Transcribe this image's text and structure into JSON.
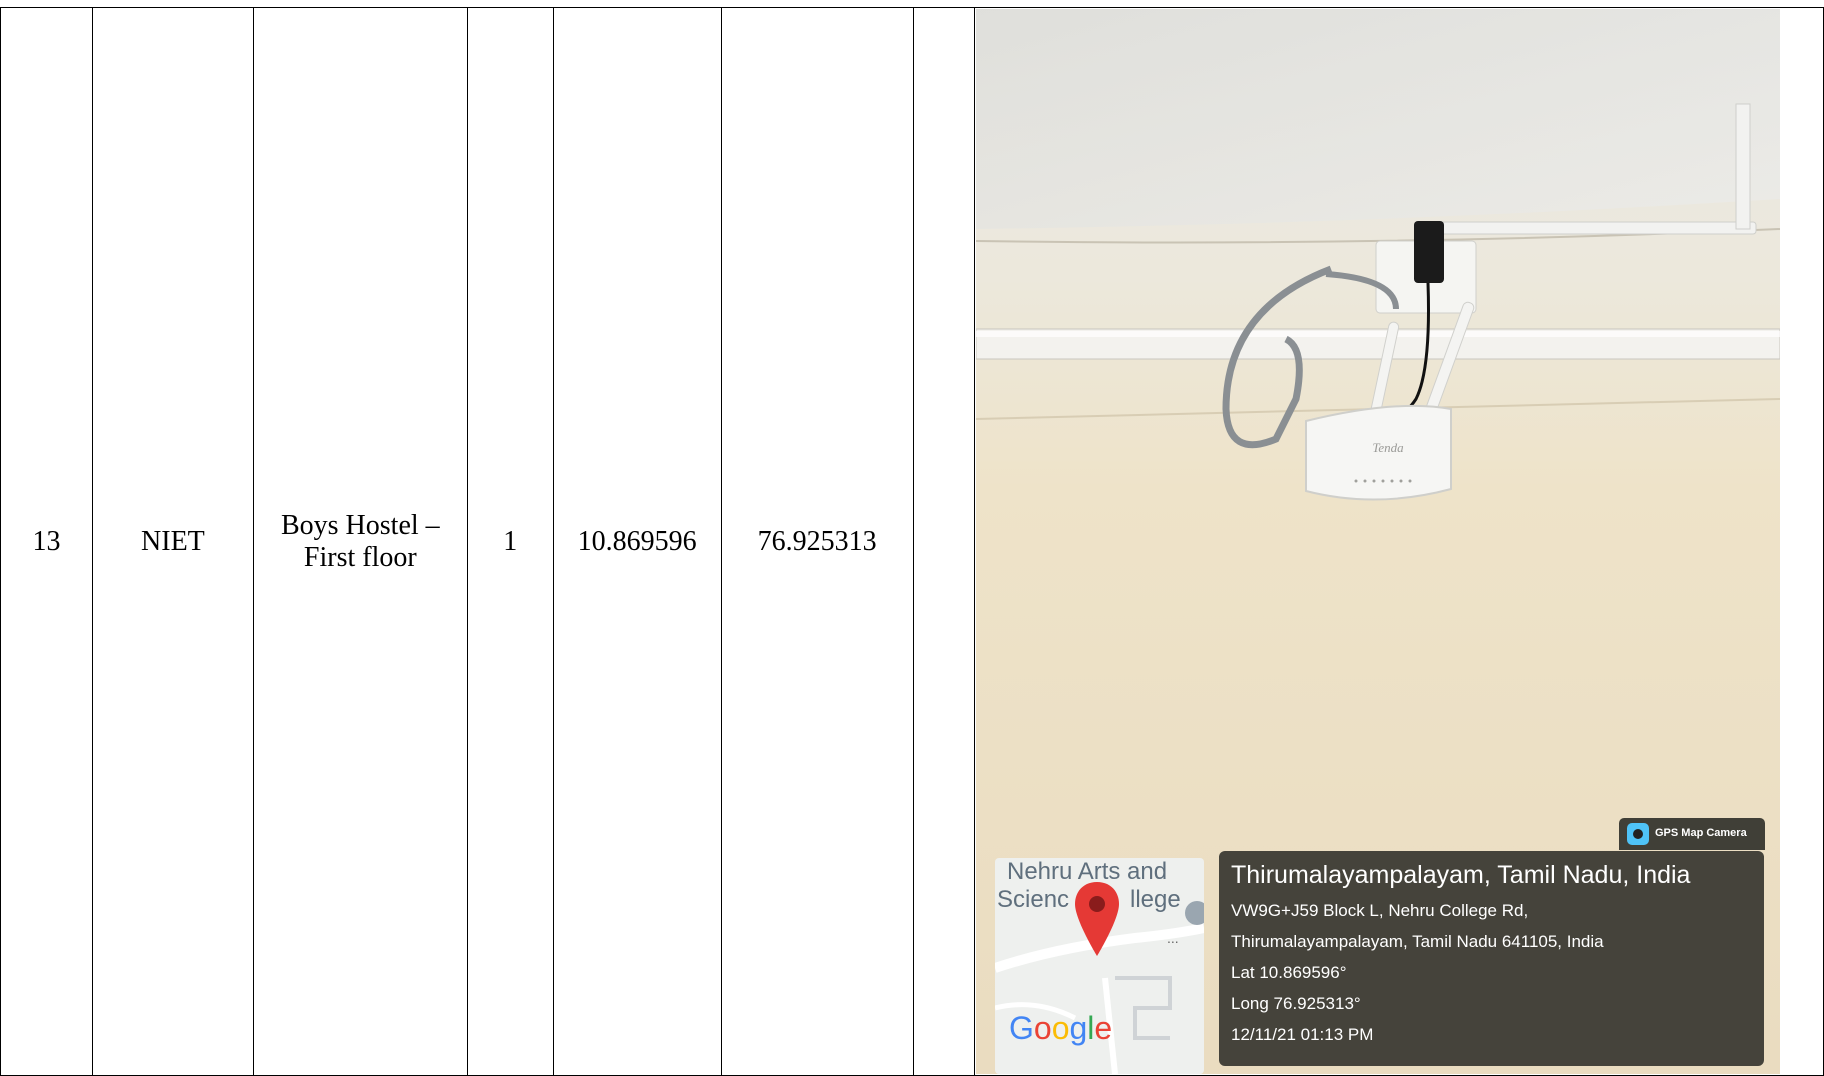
{
  "row": {
    "serial": "13",
    "institution": "NIET",
    "location_line1": "Boys Hostel –",
    "location_line2": "First floor",
    "count": "1",
    "latitude": "10.869596",
    "longitude": "76.925313"
  },
  "photo": {
    "subject": "wall-mounted Wi-Fi router",
    "router_brand_text": "Tenda",
    "gps_badge_label": "GPS Map Camera",
    "map": {
      "place_label_line1": "Nehru Arts and",
      "place_label_line2_left": "Scienc",
      "place_label_line2_right": "llege",
      "ellipsis": "...",
      "google_letters": [
        "G",
        "o",
        "o",
        "g",
        "l",
        "e"
      ],
      "google_colors": [
        "#4285F4",
        "#EA4335",
        "#FBBC05",
        "#4285F4",
        "#34A853",
        "#EA4335"
      ],
      "pin_color": "#E53935"
    },
    "overlay": {
      "place": "Thirumalayampalayam, Tamil Nadu, India",
      "address_line1": "VW9G+J59 Block L, Nehru College Rd,",
      "address_line2": "Thirumalayampalayam, Tamil Nadu 641105, India",
      "lat": "Lat 10.869596°",
      "long": "Long 76.925313°",
      "datetime": "12/11/21 01:13 PM"
    }
  }
}
